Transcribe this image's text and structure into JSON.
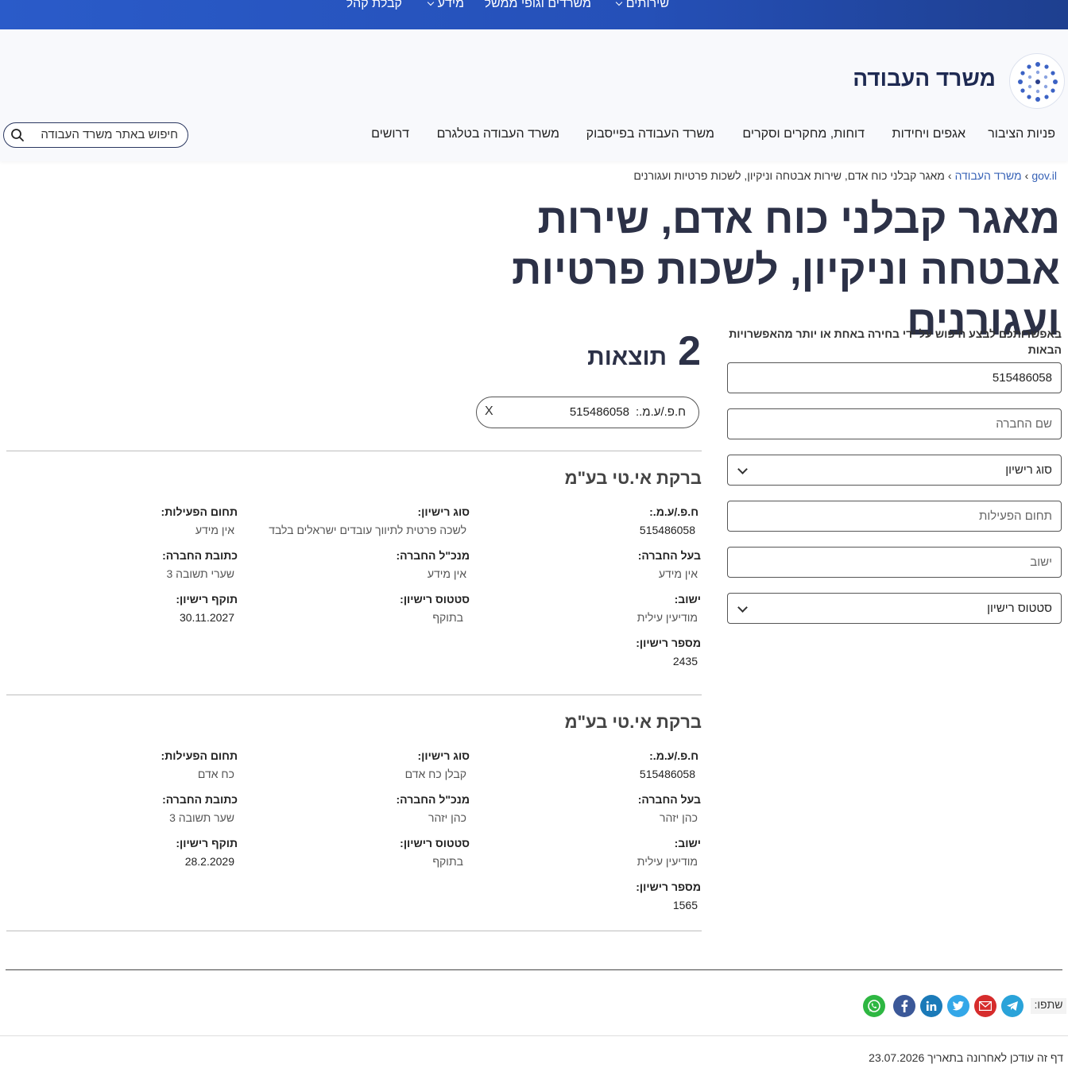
{
  "topnav": {
    "services": "שירותים",
    "ministries": "משרדים וגופי ממשל",
    "info": "מידע",
    "public_reception": "קבלת קהל"
  },
  "header": {
    "site_title": "משרד העבודה",
    "nav": [
      "פניות הציבור",
      "אגפים ויחידות",
      "דוחות, מחקרים וסקרים",
      "משרד העבודה בפייסבוק",
      "משרד העבודה בטלגרם",
      "דרושים"
    ],
    "search_placeholder": "חיפוש באתר משרד העבודה"
  },
  "breadcrumb": {
    "home": "gov.il",
    "ministry": "משרד העבודה",
    "current": "מאגר קבלני כוח אדם, שירות אבטחה וניקיון, לשכות פרטיות ועגורנים"
  },
  "page_title": "מאגר קבלני כוח אדם, שירות אבטחה וניקיון, לשכות פרטיות ועגורנים",
  "results": {
    "count": "2",
    "count_label": "תוצאות",
    "filter_chip_label": "ח.פ./ע.מ.:",
    "filter_chip_value": "515486058",
    "filter_chip_remove": "X"
  },
  "labels": {
    "company_id": "ח.פ./ע.מ.:",
    "license_type": "סוג רישיון:",
    "activity_field": "תחום הפעילות:",
    "owner": "בעל החברה:",
    "ceo": "מנכ\"ל החברה:",
    "address": "כתובת החברה:",
    "city": "ישוב:",
    "license_status": "סטטוס רישיון:",
    "license_valid": "תוקף רישיון:",
    "license_number": "מספר רישיון:"
  },
  "cards": [
    {
      "title": "ברקת אי.טי בע\"מ",
      "company_id": "515486058",
      "license_type": "לשכה פרטית לתיווך עובדים ישראלים בלבד",
      "activity_field": "אין מידע",
      "owner": "אין מידע",
      "ceo": "אין מידע",
      "address": "שערי תשובה 3",
      "city": "מודיעין עילית",
      "license_status": "בתוקף",
      "license_valid": "30.11.2027",
      "license_number": "2435"
    },
    {
      "title": "ברקת אי.טי בע\"מ",
      "company_id": "515486058",
      "license_type": "קבלן כח אדם",
      "activity_field": "כח אדם",
      "owner": "כהן יזהר",
      "ceo": "כהן יזהר",
      "address": "שער תשובה 3",
      "city": "מודיעין עילית",
      "license_status": "בתוקף",
      "license_valid": "28.2.2029",
      "license_number": "1565"
    }
  ],
  "filters": {
    "intro": "באפשרותכם לבצע חיפוש על ידי בחירה באחת או יותר מהאפשרויות הבאות",
    "company_id_value": "515486058",
    "company_name_placeholder": "שם החברה",
    "license_type_select": "סוג רישיון",
    "activity_field_placeholder": "תחום הפעילות",
    "city_placeholder": "ישוב",
    "license_status_select": "סטטוס רישיון"
  },
  "share": {
    "label": "שתפו:",
    "icons": [
      "telegram-icon",
      "email-icon",
      "twitter-icon",
      "linkedin-icon",
      "facebook-icon",
      "whatsapp-icon"
    ],
    "colors": {
      "telegram": "#2aa3d9",
      "email": "#d62c2c",
      "twitter": "#33a7e8",
      "linkedin": "#1b7ab8",
      "facebook": "#3b5898",
      "whatsapp": "#2eb742"
    }
  },
  "footer": {
    "last_updated": "דף זה עודכן לאחרונה בתאריך 23.07.2026"
  },
  "colors": {
    "topbar": "#2550b8",
    "title": "#2c3147",
    "link": "#3762b6"
  }
}
